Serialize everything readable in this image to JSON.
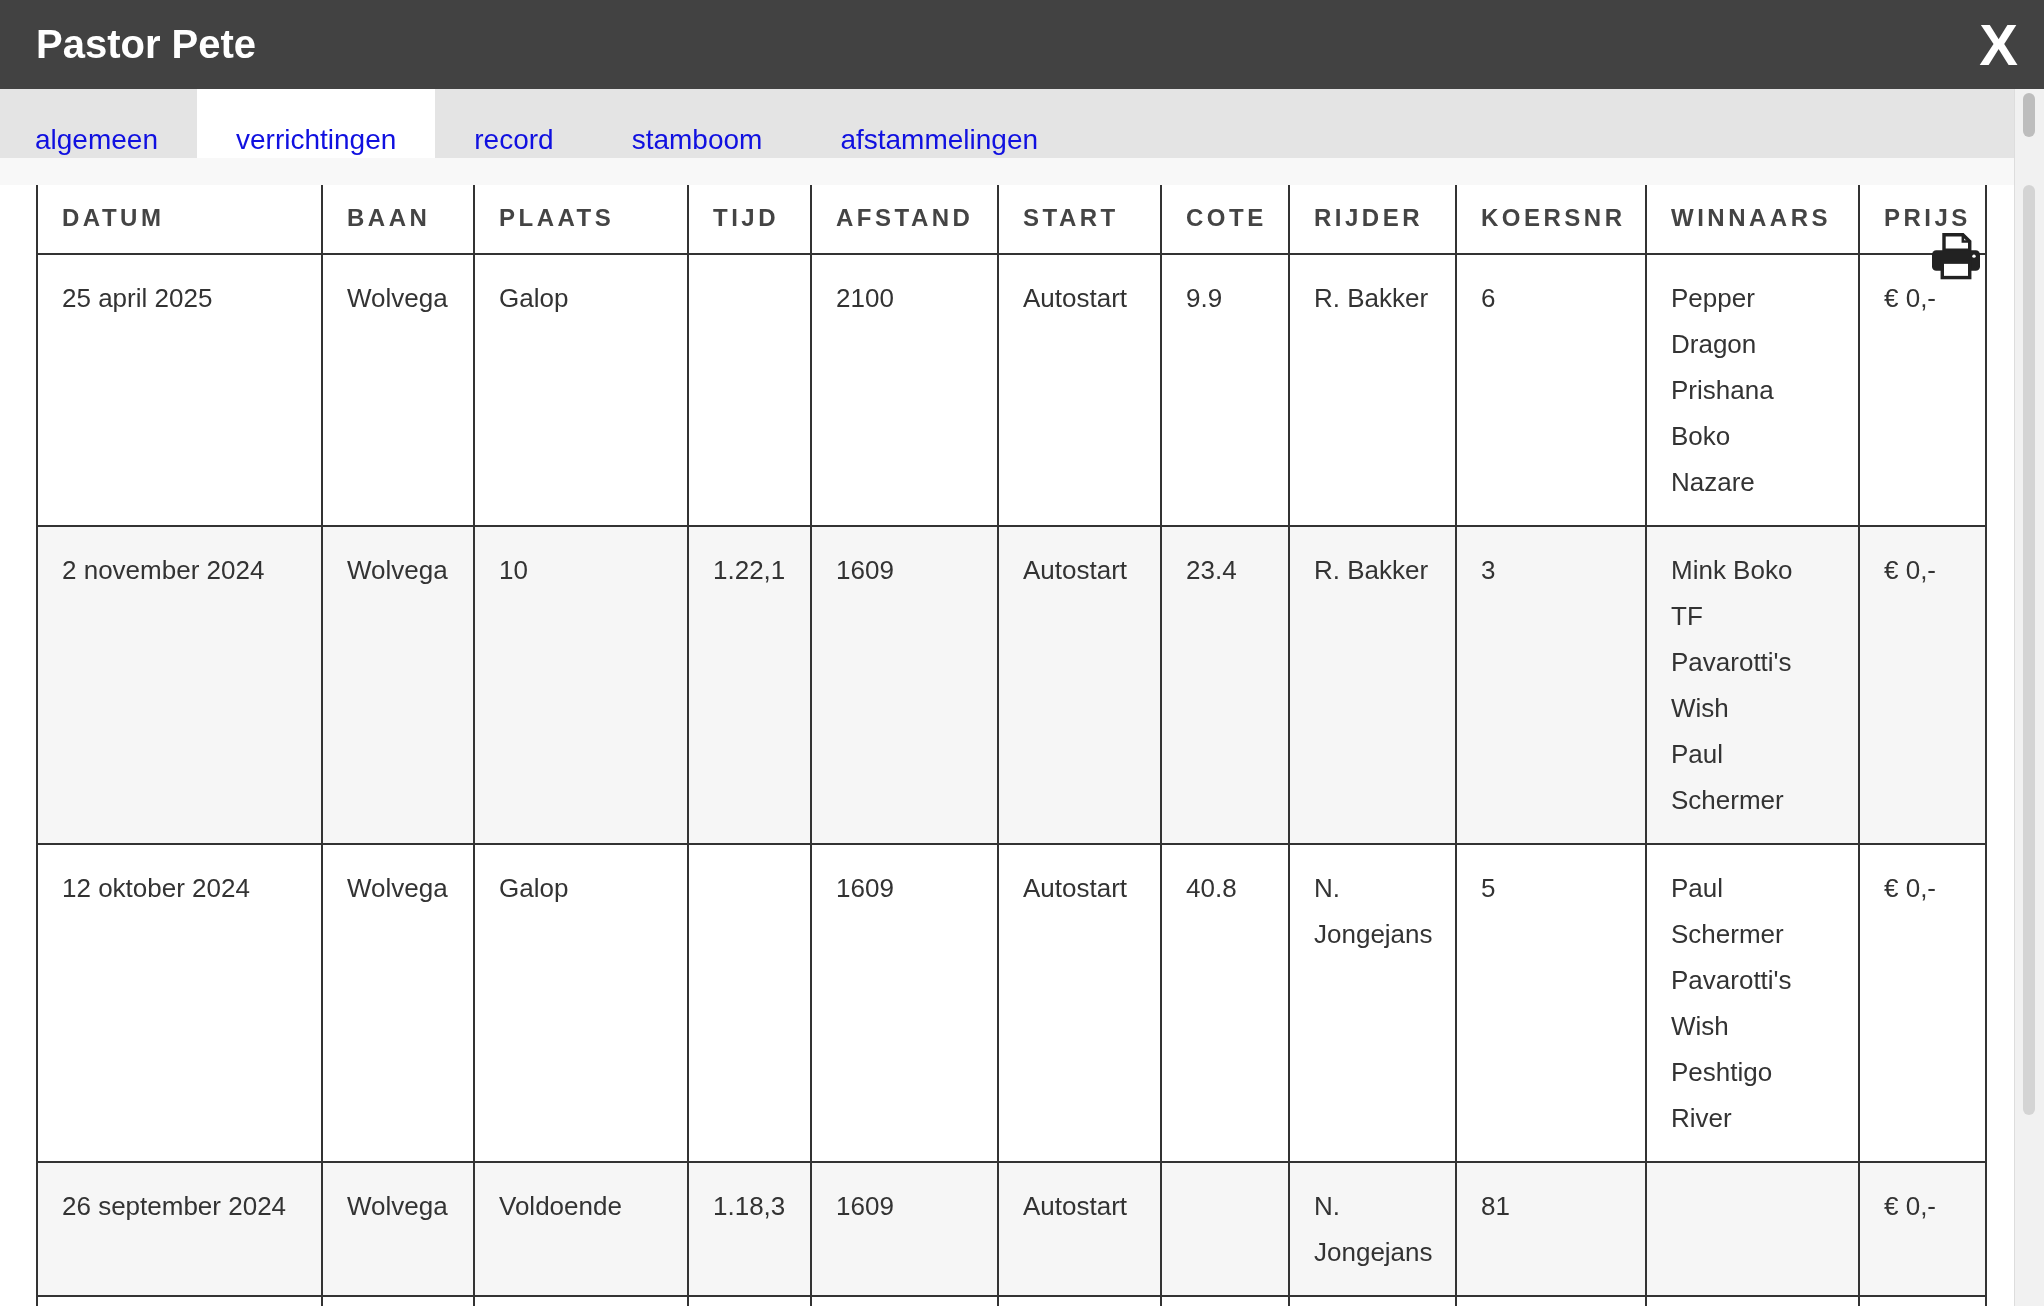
{
  "window": {
    "title": "Pastor Pete",
    "close": "X"
  },
  "tabs": [
    {
      "label": "algemeen",
      "selected": false
    },
    {
      "label": "verrichtingen",
      "selected": true
    },
    {
      "label": "record",
      "selected": false
    },
    {
      "label": "stamboom",
      "selected": false
    },
    {
      "label": "afstammelingen",
      "selected": false
    }
  ],
  "table": {
    "columns": [
      "DATUM",
      "BAAN",
      "PLAATS",
      "TIJD",
      "AFSTAND",
      "START",
      "COTE",
      "RIJDER",
      "KOERSNR",
      "WINNAARS",
      "PRIJS"
    ],
    "rows": [
      {
        "datum": "25 april 2025",
        "baan": "Wolvega",
        "plaats": "Galop",
        "tijd": "",
        "afstand": "2100",
        "start": "Autostart",
        "cote": "9.9",
        "rijder": "R. Bakker",
        "koersnr": "6",
        "winnaars": [
          "Pepper Dragon",
          "Prishana Boko",
          "Nazare"
        ],
        "prijs": "€ 0,-"
      },
      {
        "datum": "2 november 2024",
        "baan": "Wolvega",
        "plaats": "10",
        "tijd": "1.22,1",
        "afstand": "1609",
        "start": "Autostart",
        "cote": "23.4",
        "rijder": "R. Bakker",
        "koersnr": "3",
        "winnaars": [
          "Mink Boko TF",
          "Pavarotti's Wish",
          "Paul Schermer"
        ],
        "prijs": "€ 0,-"
      },
      {
        "datum": "12 oktober 2024",
        "baan": "Wolvega",
        "plaats": "Galop",
        "tijd": "",
        "afstand": "1609",
        "start": "Autostart",
        "cote": "40.8",
        "rijder": "N. Jongejans",
        "koersnr": "5",
        "winnaars": [
          "Paul Schermer",
          "Pavarotti's Wish",
          "Peshtigo River"
        ],
        "prijs": "€ 0,-"
      },
      {
        "datum": "26 september 2024",
        "baan": "Wolvega",
        "plaats": "Voldoende",
        "tijd": "1.18,3",
        "afstand": "1609",
        "start": "Autostart",
        "cote": "",
        "rijder": "N. Jongejans",
        "koersnr": "81",
        "winnaars": [],
        "prijs": "€ 0,-"
      }
    ]
  }
}
